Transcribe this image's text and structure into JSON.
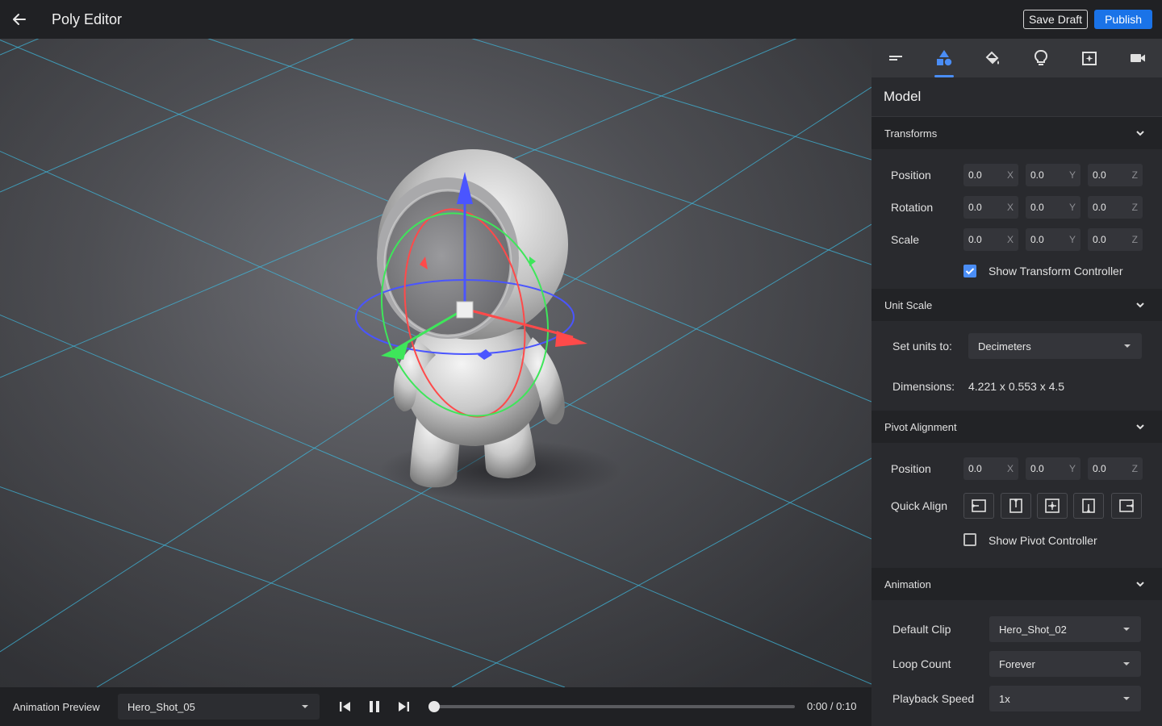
{
  "header": {
    "title": "Poly Editor",
    "save_draft_label": "Save Draft",
    "publish_label": "Publish"
  },
  "bottom_bar": {
    "animation_preview_label": "Animation Preview",
    "clip_selected": "Hero_Shot_05",
    "time_display": "0:00 / 0:10",
    "progress": 0.0
  },
  "panel": {
    "tabs": [
      {
        "icon": "text-align-icon"
      },
      {
        "icon": "shapes-icon",
        "active": true
      },
      {
        "icon": "paint-bucket-icon"
      },
      {
        "icon": "lightbulb-icon"
      },
      {
        "icon": "image-sparkle-icon"
      },
      {
        "icon": "video-camera-icon"
      }
    ],
    "title": "Model",
    "transforms": {
      "header": "Transforms",
      "position_label": "Position",
      "rotation_label": "Rotation",
      "scale_label": "Scale",
      "position": {
        "x": "0.0",
        "y": "0.0",
        "z": "0.0"
      },
      "rotation": {
        "x": "0.0",
        "y": "0.0",
        "z": "0.0"
      },
      "scale": {
        "x": "0.0",
        "y": "0.0",
        "z": "0.0"
      },
      "axis_x": "X",
      "axis_y": "Y",
      "axis_z": "Z",
      "show_controller_label": "Show Transform Controller",
      "show_controller_checked": true
    },
    "unit_scale": {
      "header": "Unit Scale",
      "set_units_label": "Set units to:",
      "units_value": "Decimeters",
      "dimensions_label": "Dimensions:",
      "dimensions_value": "4.221 x 0.553 x 4.5"
    },
    "pivot": {
      "header": "Pivot Alignment",
      "position_label": "Position",
      "position": {
        "x": "0.0",
        "y": "0.0",
        "z": "0.0"
      },
      "quick_align_label": "Quick Align",
      "show_pivot_label": "Show Pivot Controller",
      "show_pivot_checked": false
    },
    "animation": {
      "header": "Animation",
      "default_clip_label": "Default Clip",
      "default_clip_value": "Hero_Shot_02",
      "loop_count_label": "Loop Count",
      "loop_count_value": "Forever",
      "playback_speed_label": "Playback Speed",
      "playback_speed_value": "1x"
    }
  },
  "colors": {
    "accent": "#1a73e8",
    "tab_accent": "#4a8df6",
    "grid_line": "#3fb6d9",
    "gizmo_x": "#ff4a4a",
    "gizmo_y": "#3ee65a",
    "gizmo_z": "#4a55ff"
  }
}
